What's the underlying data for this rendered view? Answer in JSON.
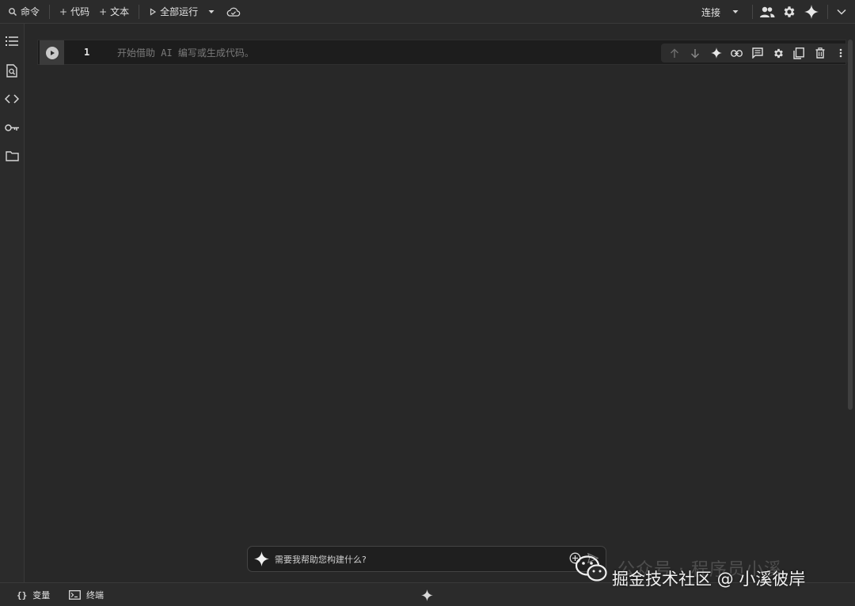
{
  "toolbar": {
    "command_label": "命令",
    "add_code_label": "代码",
    "add_text_label": "文本",
    "run_all_label": "全部运行",
    "connect_label": "连接"
  },
  "cell": {
    "line_number": "1",
    "placeholder": "开始借助 AI 编写或生成代码。"
  },
  "ai_prompt": {
    "placeholder": "需要我帮助您构建什么?"
  },
  "statusbar": {
    "variables_label": "变量",
    "terminal_label": "终端"
  },
  "watermark": {
    "back_text": "公众号 · 程序员小溪",
    "front_text": "掘金技术社区 @ 小溪彼岸"
  },
  "icons": {
    "rail": [
      "table-of-contents-icon",
      "find-in-page-icon",
      "code-snippets-icon",
      "secrets-key-icon",
      "files-folder-icon"
    ],
    "cell_tools": [
      "move-up-icon",
      "move-down-icon",
      "gemini-spark-icon",
      "link-icon",
      "comment-icon",
      "settings-icon",
      "mirror-cell-icon",
      "delete-icon",
      "more-vert-icon"
    ]
  },
  "colors": {
    "background": "#292929",
    "cell_background": "#1d1d1d",
    "text": "#e2e2e2",
    "placeholder": "#7a7a7a"
  }
}
